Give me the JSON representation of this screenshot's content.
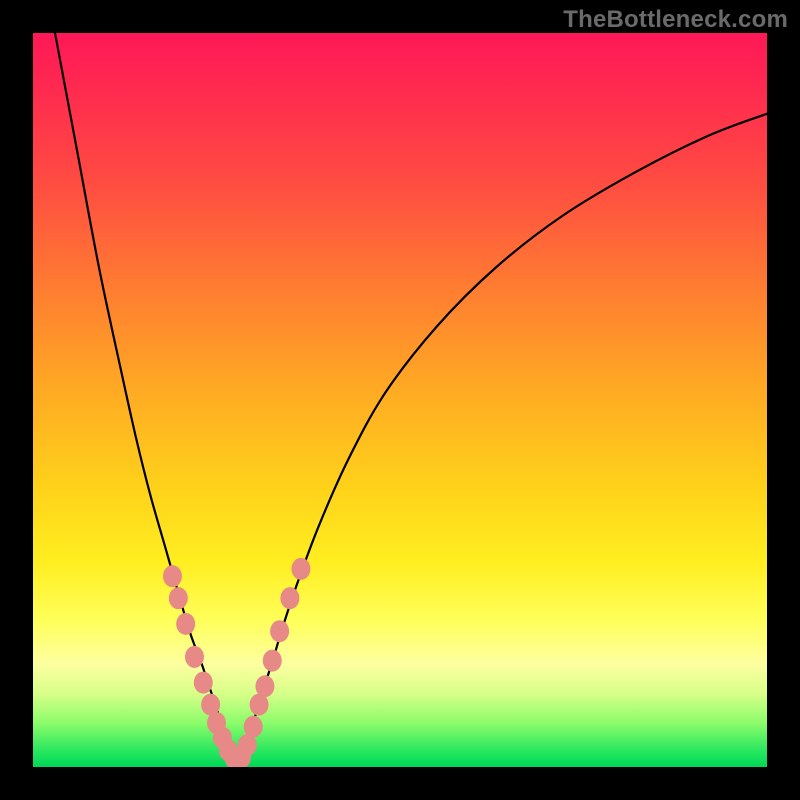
{
  "watermark": "TheBottleneck.com",
  "colors": {
    "frame": "#000000",
    "curve": "#000000",
    "marker_fill": "#e78a87",
    "marker_stroke": "#d97a78"
  },
  "chart_data": {
    "type": "line",
    "title": "",
    "xlabel": "",
    "ylabel": "",
    "xlim": [
      0,
      100
    ],
    "ylim": [
      0,
      100
    ],
    "grid": false,
    "legend": false,
    "series": [
      {
        "name": "left-branch",
        "x": [
          3,
          6,
          9,
          12,
          14,
          16,
          18,
          20,
          21.5,
          23,
          24,
          25,
          25.8,
          26.5,
          27.2,
          28
        ],
        "y": [
          100,
          84,
          68,
          54,
          45,
          37,
          30,
          23,
          18,
          14,
          11,
          8,
          5.5,
          3.5,
          2,
          1
        ]
      },
      {
        "name": "right-branch",
        "x": [
          28,
          29,
          30,
          31,
          32.5,
          34,
          36,
          39,
          43,
          48,
          55,
          63,
          72,
          82,
          92,
          100
        ],
        "y": [
          1,
          3,
          6,
          9.5,
          14,
          19,
          25,
          33,
          42,
          51,
          60,
          68,
          75,
          81,
          86,
          89
        ]
      }
    ],
    "markers": [
      {
        "x": 19.0,
        "y": 26.0
      },
      {
        "x": 19.8,
        "y": 23.0
      },
      {
        "x": 20.8,
        "y": 19.5
      },
      {
        "x": 22.0,
        "y": 15.0
      },
      {
        "x": 23.2,
        "y": 11.5
      },
      {
        "x": 24.2,
        "y": 8.5
      },
      {
        "x": 25.0,
        "y": 6.0
      },
      {
        "x": 25.8,
        "y": 4.0
      },
      {
        "x": 26.6,
        "y": 2.3
      },
      {
        "x": 27.4,
        "y": 1.2
      },
      {
        "x": 28.4,
        "y": 1.3
      },
      {
        "x": 29.2,
        "y": 3.0
      },
      {
        "x": 30.0,
        "y": 5.5
      },
      {
        "x": 30.8,
        "y": 8.5
      },
      {
        "x": 31.6,
        "y": 11.0
      },
      {
        "x": 32.6,
        "y": 14.5
      },
      {
        "x": 33.6,
        "y": 18.5
      },
      {
        "x": 35.0,
        "y": 23.0
      },
      {
        "x": 36.5,
        "y": 27.0
      }
    ]
  }
}
